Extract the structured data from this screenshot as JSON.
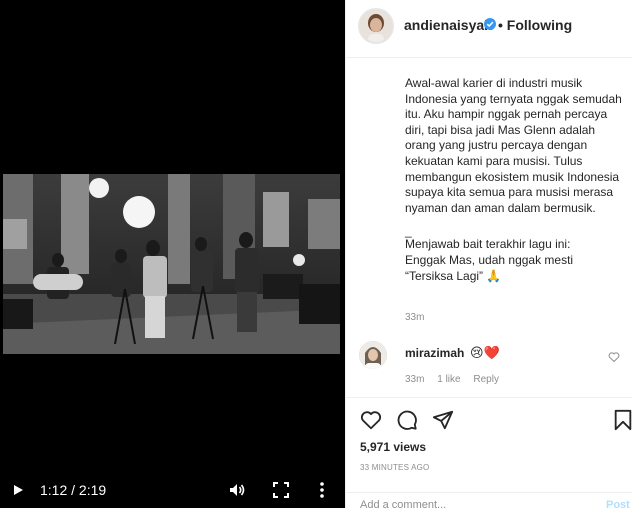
{
  "video": {
    "time": "1:12 / 2:19",
    "play_icon": "play-icon",
    "volume_icon": "volume-icon",
    "fullscreen_icon": "fullscreen-icon",
    "more_icon": "more-vertical-icon"
  },
  "post": {
    "username": "andienaisyah",
    "verified_separator": "•",
    "following_label": "Following",
    "caption_paragraphs": [
      "Awal-awal karier di industri musik Indonesia yang ternyata nggak semudah itu. Aku hampir nggak pernah percaya diri, tapi bisa jadi Mas Glenn adalah orang yang justru percaya dengan kekuatan kami para musisi. Tulus membangun ekosistem musik Indonesia supaya kita semua para musisi merasa nyaman dan aman dalam bermusik.",
      "_",
      "Menjawab bait terakhir lagu ini:\nEnggak Mas, udah nggak mesti\n“Tersiksa Lagi” 🙏"
    ],
    "caption_time": "33m"
  },
  "comment": {
    "username": "mirazimah",
    "text": "😢❤️",
    "time": "33m",
    "likes": "1 like",
    "reply_label": "Reply"
  },
  "actions": {
    "views": "5,971 views",
    "posted": "33 MINUTES AGO",
    "add_comment_placeholder": "Add a comment...",
    "post_label": "Post"
  },
  "colors": {
    "verified_blue": "#3897f0",
    "muted_text": "#8e8e8e",
    "post_button": "#b2dffc"
  }
}
